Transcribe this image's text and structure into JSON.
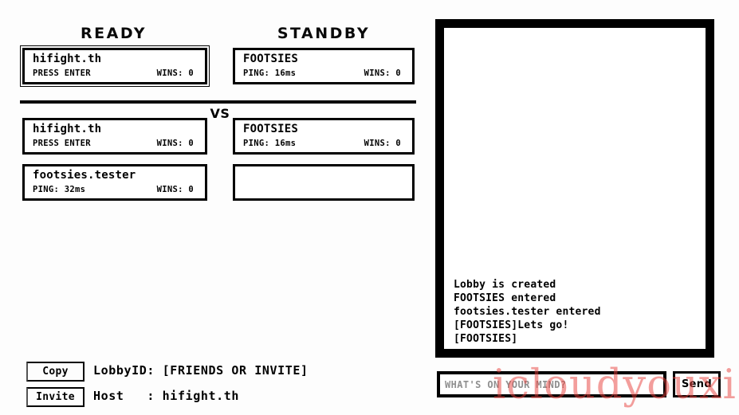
{
  "headers": {
    "ready": "READY",
    "standby": "STANDBY",
    "vs": "VS"
  },
  "slots": {
    "rows": [
      {
        "left": {
          "name": "hifight.th",
          "status": "PRESS ENTER",
          "wins": "WINS: 0",
          "selected": true,
          "empty": false
        },
        "right": {
          "name": "FOOTSIES",
          "status": "PING: 16ms",
          "wins": "WINS: 0",
          "selected": false,
          "empty": false
        }
      },
      {
        "left": {
          "name": "hifight.th",
          "status": "PRESS ENTER",
          "wins": "WINS: 0",
          "selected": false,
          "empty": false
        },
        "right": {
          "name": "FOOTSIES",
          "status": "PING: 16ms",
          "wins": "WINS: 0",
          "selected": false,
          "empty": false
        }
      },
      {
        "left": {
          "name": "footsies.tester",
          "status": "PING: 32ms",
          "wins": "WINS: 0",
          "selected": false,
          "empty": false
        },
        "right": {
          "name": "",
          "status": "",
          "wins": "",
          "selected": false,
          "empty": true
        }
      }
    ]
  },
  "lobby_info": {
    "copy_button": "Copy",
    "invite_button": "Invite",
    "lobby_id_line": "LobbyID: [FRIENDS OR INVITE]",
    "host_line": "Host   : hifight.th"
  },
  "chat": {
    "log": [
      "Lobby is created",
      "FOOTSIES entered",
      "footsies.tester entered",
      "[FOOTSIES]Lets go!",
      "[FOOTSIES]"
    ],
    "input_value": "",
    "input_placeholder": "WHAT'S ON YOUR MIND?",
    "send_label": "Send"
  },
  "watermark": {
    "text": "icloudyouxi"
  },
  "colors": {
    "background": "#fdfdfd",
    "foreground": "#000000",
    "panel": "#ffffff",
    "placeholder": "#8f8f8f",
    "watermark": "#e8403c"
  }
}
